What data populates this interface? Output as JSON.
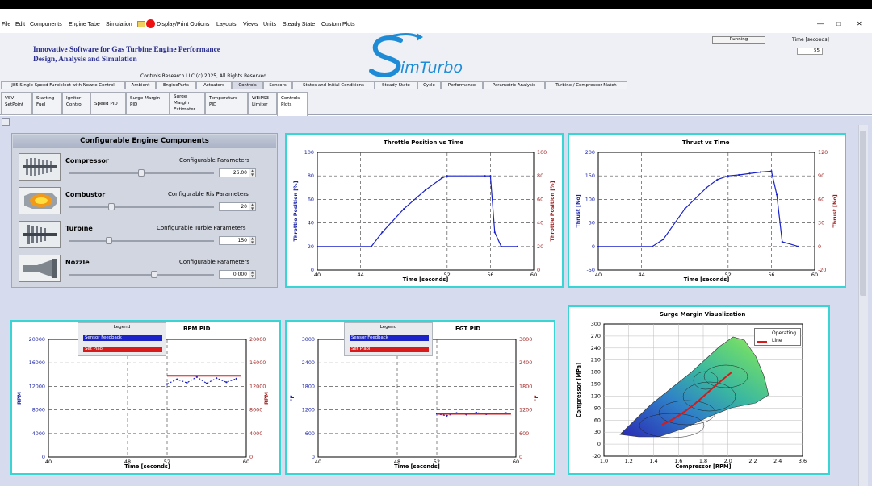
{
  "menu": {
    "items": [
      "File",
      "Edit",
      "Components",
      "Engine Tabe",
      "Simulation",
      "Display/Print Options",
      "Layouts",
      "Views",
      "Units",
      "Steady State",
      "Custom Plots"
    ]
  },
  "header": {
    "title_line1": "Innovative Software for Gas Turbine Engine Performance",
    "title_line2": "Design, Analysis and Simulation",
    "logo": "SimTurbo",
    "copyright": "Controls Research LLC    (c) 2025,  All Rights Reserved",
    "status": "Running",
    "time_label": "Time [seconds]",
    "time_value": "55"
  },
  "tabs_main": [
    "J85 Single Speed Furbicleet with Nozzle Control",
    "Ambient",
    "EngineParts",
    "Actuators",
    "Controls",
    "Sensors",
    "States and Initial Conditions",
    "Steady State",
    "Cycle",
    "Performance",
    "Parametric Analysis",
    "Turbine / Compressor Match"
  ],
  "tabs_controls": [
    "VSV\nSetPoint",
    "Starting\nFuel",
    "Ignitor\nControl",
    "Speed PID",
    "Surge Margin\nPID",
    "Surge\nMargin\nEstimater",
    "Temperature\nPID",
    "WEiPS3\nLimiter",
    "Controls\nPlots"
  ],
  "config": {
    "title": "Configurable Engine Components",
    "components": [
      {
        "name": "Compressor",
        "param_label": "Configurable Parameters",
        "value": "26.00",
        "level": 0.56
      },
      {
        "name": "Combustor",
        "param_label": "Configurable Ris Parameters",
        "value": "20",
        "level": 0.28
      },
      {
        "name": "Turbine",
        "param_label": "Configurable Turble Parameters",
        "value": "150",
        "level": 0.27
      },
      {
        "name": "Nozzle",
        "param_label": "Configurable Parameters",
        "value": "0.000",
        "level": 0.59
      }
    ]
  },
  "charts": {
    "throttle": {
      "title": "Throttle Position vs Time",
      "xlabel": "Time  [seconds]",
      "ylabel_left": "Throttle Position [%]",
      "ylabel_right": "Throttle Position [%]",
      "xticks": [
        "40",
        "44",
        "52",
        "56",
        "60"
      ],
      "yticks_left": [
        "100",
        "80",
        "60",
        "40",
        "20",
        "0"
      ],
      "yticks_right": [
        "100",
        "80",
        "60",
        "40",
        "20",
        "0"
      ]
    },
    "thrust": {
      "title": "Thrust vs Time",
      "xlabel": "Time  [seconds]",
      "ylabel_left": "Thrust [No]",
      "ylabel_right": "Thrust [No]",
      "xticks": [
        "40",
        "44",
        "52",
        "56",
        "60"
      ],
      "yticks_left": [
        "200",
        "150",
        "100",
        "50",
        "0",
        "-50"
      ],
      "yticks_right": [
        "120",
        "90",
        "60",
        "30",
        "0",
        "-20"
      ]
    },
    "rpm": {
      "title": "RPM PID",
      "xlabel": "Time  [seconds]",
      "ylabel_left": "RPM",
      "ylabel_right": "RPM",
      "xticks": [
        "40",
        "48",
        "52",
        "60"
      ],
      "yticks_left": [
        "20000",
        "16000",
        "12000",
        "8000",
        "4000",
        "0"
      ],
      "yticks_right": [
        "20000",
        "16000",
        "12000",
        "8000",
        "4000",
        "0"
      ],
      "legend_title": "Legend",
      "legend_items": [
        "Sensor Feedback",
        "Set Plaol"
      ]
    },
    "egt": {
      "title": "EGT PID",
      "xlabel": "Time  [seconds]",
      "ylabel_left": "°F",
      "ylabel_right": "°F",
      "xticks": [
        "40",
        "48",
        "52",
        "60"
      ],
      "yticks_left": [
        "3000",
        "2400",
        "1800",
        "1200",
        "600",
        "0"
      ],
      "yticks_right": [
        "3000",
        "2400",
        "1800",
        "1200",
        "600",
        "0"
      ],
      "legend_title": "Legend",
      "legend_items": [
        "Sensor Feedback",
        "Set Plaol"
      ]
    },
    "surge": {
      "title": "Surge Margin Visualization",
      "xlabel": "Compressor [RPM]",
      "ylabel": "Compressor [MPa]",
      "xticks": [
        "1.0",
        "1.2",
        "1.4",
        "1.6",
        "1.8",
        "2.0",
        "2.2",
        "2.4",
        "3.6"
      ],
      "yticks": [
        "300",
        "270",
        "240",
        "210",
        "180",
        "150",
        "120",
        "90",
        "60",
        "30",
        "0",
        "-20"
      ],
      "legend_items": [
        "Operating",
        "Line"
      ]
    }
  },
  "chart_data": [
    {
      "type": "line",
      "title": "Throttle Position vs Time",
      "xlabel": "Time  [seconds]",
      "ylabel": "Throttle Position [%]",
      "xlim": [
        40,
        60
      ],
      "ylim": [
        0,
        100
      ],
      "series": [
        {
          "x": [
            40,
            45,
            46,
            48,
            50,
            51.5,
            52,
            55.5,
            56,
            56.4,
            57,
            58.5
          ],
          "y": [
            20,
            20,
            32,
            52,
            68,
            78,
            80,
            80,
            80,
            32,
            20,
            20
          ]
        }
      ]
    },
    {
      "type": "line",
      "title": "Thrust vs Time",
      "xlabel": "Time  [seconds]",
      "ylabel": "Thrust [No]",
      "xlim": [
        40,
        60
      ],
      "ylim": [
        -50,
        200
      ],
      "series": [
        {
          "x": [
            40,
            45,
            46,
            48,
            50,
            51,
            52,
            53,
            54,
            55,
            56,
            56.5,
            57,
            58.5
          ],
          "y": [
            0,
            0,
            15,
            80,
            125,
            142,
            150,
            152,
            155,
            158,
            160,
            110,
            10,
            0
          ]
        }
      ]
    },
    {
      "type": "line",
      "title": "RPM PID",
      "xlabel": "Time  [seconds]",
      "ylabel": "RPM",
      "xlim": [
        40,
        60
      ],
      "ylim": [
        0,
        20000
      ],
      "series": [
        {
          "name": "Sensor Feedback",
          "x": [
            52,
            53,
            54,
            55,
            56,
            57,
            58,
            59
          ],
          "y": [
            12400,
            13200,
            12600,
            13600,
            12500,
            13400,
            12700,
            13300
          ]
        },
        {
          "name": "Set Plaol",
          "x": [
            52,
            59.5
          ],
          "y": [
            13800,
            13800
          ]
        }
      ]
    },
    {
      "type": "line",
      "title": "EGT PID",
      "xlabel": "Time  [seconds]",
      "ylabel": "°F",
      "xlim": [
        40,
        60
      ],
      "ylim": [
        0,
        3000
      ],
      "series": [
        {
          "name": "Sensor Feedback",
          "x": [
            52,
            53,
            54,
            55,
            56,
            57,
            58,
            59
          ],
          "y": [
            1100,
            1050,
            1120,
            1080,
            1130,
            1090,
            1110,
            1120
          ]
        },
        {
          "name": "Set Plaol",
          "x": [
            52,
            59.5
          ],
          "y": [
            1100,
            1100
          ]
        }
      ]
    }
  ],
  "colors": {
    "accent": "#39d5d5",
    "blue": "#1a22c8",
    "red": "#d81a1a",
    "axis_right": "#9b1b1b",
    "axis_left": "#1a22a8"
  }
}
